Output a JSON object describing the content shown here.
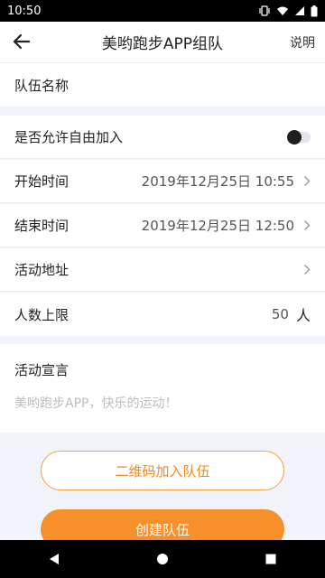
{
  "status_bar": {
    "time": "10:50"
  },
  "header": {
    "title": "美哟跑步APP组队",
    "help_label": "说明"
  },
  "form": {
    "team_name_label": "队伍名称",
    "allow_join_label": "是否允许自由加入",
    "allow_join_enabled": false,
    "start_time_label": "开始时间",
    "start_time_value": "2019年12月25日 10:55",
    "end_time_label": "结束时间",
    "end_time_value": "2019年12月25日 12:50",
    "address_label": "活动地址",
    "max_people_label": "人数上限",
    "max_people_value": "50",
    "max_people_unit": "人",
    "declaration_label": "活动宣言",
    "declaration_text": "美哟跑步APP，快乐的运动！"
  },
  "buttons": {
    "qr_join": "二维码加入队伍",
    "create_team": "创建队伍"
  },
  "colors": {
    "accent": "#f5902a",
    "accent_text": "#f08a1c",
    "background": "#f1f4f8"
  }
}
